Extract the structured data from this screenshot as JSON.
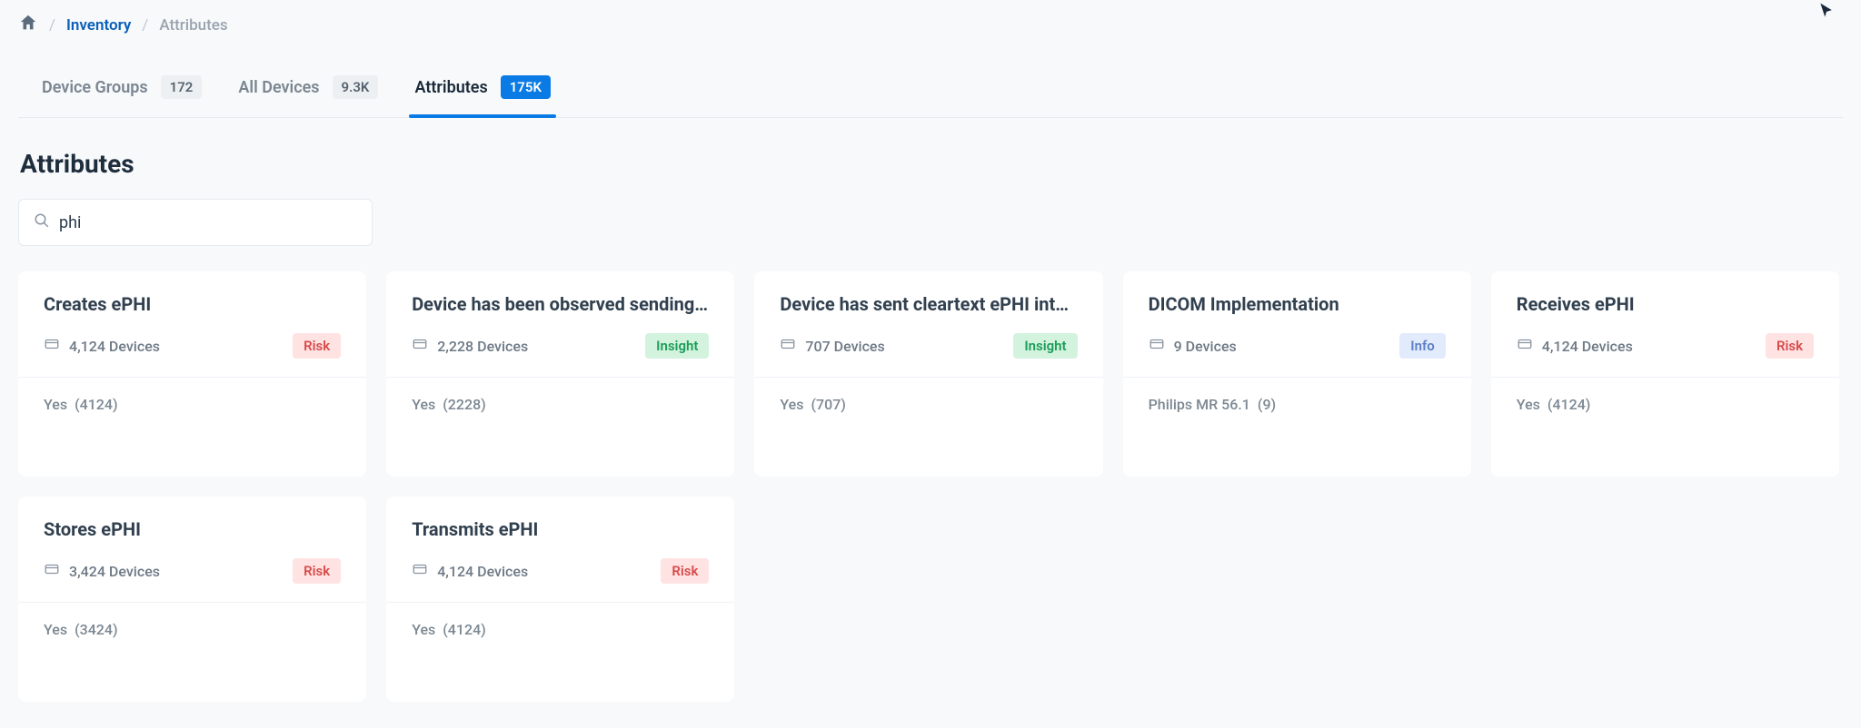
{
  "breadcrumb": {
    "link": "Inventory",
    "current": "Attributes"
  },
  "tabs": [
    {
      "label": "Device Groups",
      "count": "172",
      "active": false
    },
    {
      "label": "All Devices",
      "count": "9.3K",
      "active": false
    },
    {
      "label": "Attributes",
      "count": "175K",
      "active": true
    }
  ],
  "page_title": "Attributes",
  "search": {
    "value": "phi",
    "placeholder": ""
  },
  "cards": [
    {
      "title": "Creates ePHI",
      "devices": "4,124 Devices",
      "badge": {
        "text": "Risk",
        "class": "badge-risk"
      },
      "value_label": "Yes",
      "value_count": "(4124)"
    },
    {
      "title": "Device has been observed sending…",
      "devices": "2,228 Devices",
      "badge": {
        "text": "Insight",
        "class": "badge-insight"
      },
      "value_label": "Yes",
      "value_count": "(2228)"
    },
    {
      "title": "Device has sent cleartext ePHI inte…",
      "devices": "707 Devices",
      "badge": {
        "text": "Insight",
        "class": "badge-insight"
      },
      "value_label": "Yes",
      "value_count": "(707)"
    },
    {
      "title": "DICOM Implementation",
      "devices": "9 Devices",
      "badge": {
        "text": "Info",
        "class": "badge-info"
      },
      "value_label": "Philips MR 56.1",
      "value_count": "(9)"
    },
    {
      "title": "Receives ePHI",
      "devices": "4,124 Devices",
      "badge": {
        "text": "Risk",
        "class": "badge-risk"
      },
      "value_label": "Yes",
      "value_count": "(4124)"
    },
    {
      "title": "Stores ePHI",
      "devices": "3,424 Devices",
      "badge": {
        "text": "Risk",
        "class": "badge-risk"
      },
      "value_label": "Yes",
      "value_count": "(3424)"
    },
    {
      "title": "Transmits ePHI",
      "devices": "4,124 Devices",
      "badge": {
        "text": "Risk",
        "class": "badge-risk"
      },
      "value_label": "Yes",
      "value_count": "(4124)"
    }
  ]
}
